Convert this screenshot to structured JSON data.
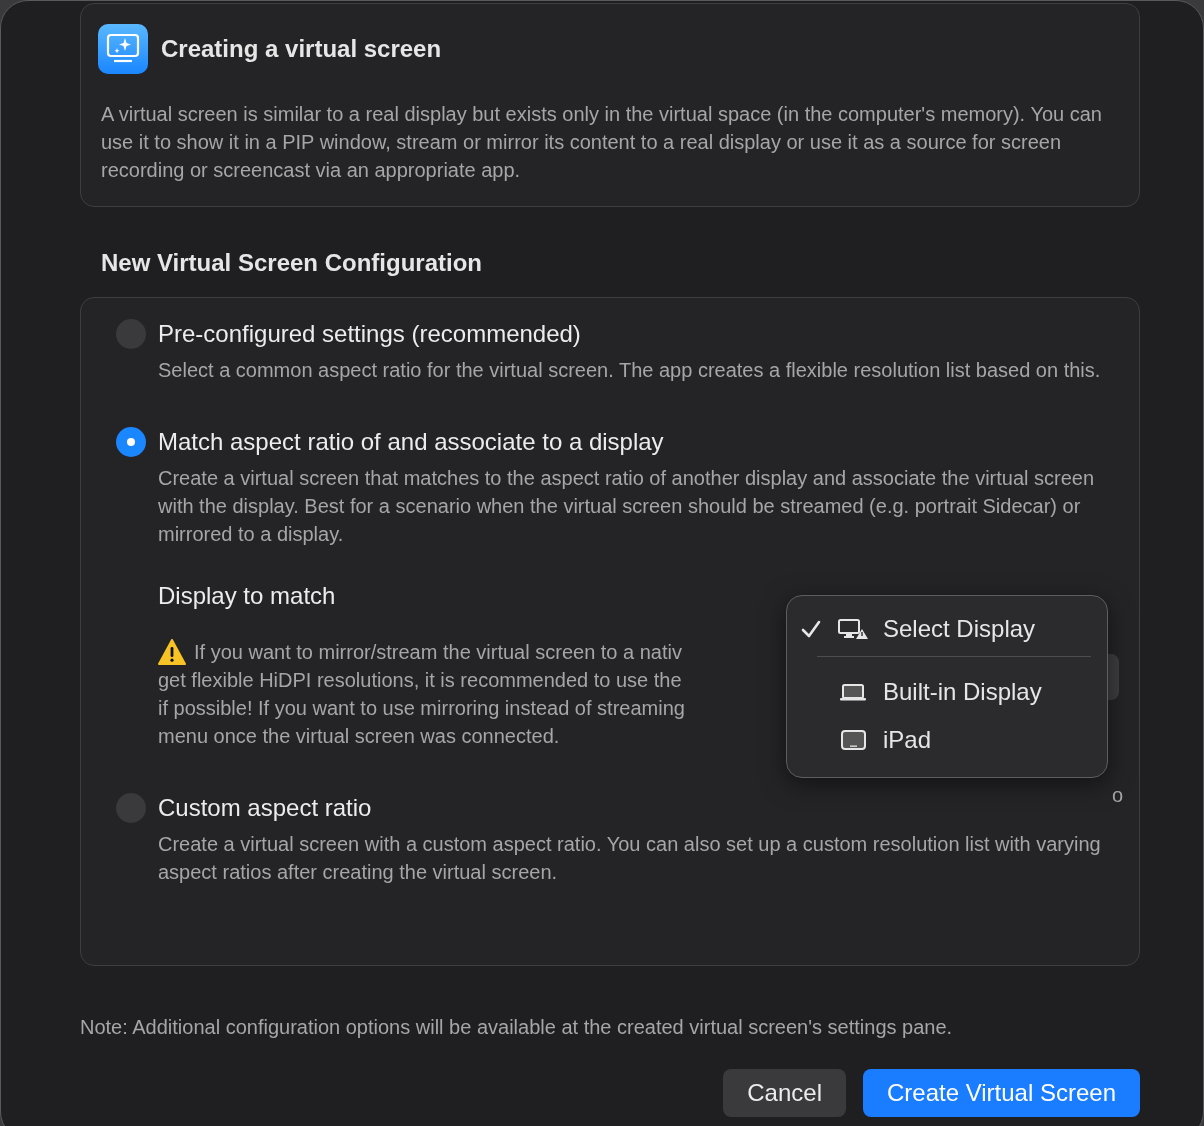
{
  "intro": {
    "title": "Creating a virtual screen",
    "text": "A virtual screen is similar to a real display but exists only in the virtual space (in the computer's memory). You can use it to show it in a PIP window, stream or mirror its content to a real display or use it as a source for screen recording or screencast via an appropriate app."
  },
  "section_title": "New Virtual Screen Configuration",
  "options": [
    {
      "title": "Pre-configured settings (recommended)",
      "selected": false,
      "text": "Select a common aspect ratio for the virtual screen. The app creates a flexible resolution list based on this."
    },
    {
      "title": "Match aspect ratio of and associate to a display",
      "selected": true,
      "text": "Create a virtual screen that matches to the aspect ratio of another display and associate the virtual screen with the display. Best for a scenario when the virtual screen should be streamed (e.g. portrait Sidecar) or mirrored to a display.",
      "display_label": "Display to match",
      "warning_lines": [
        "If you want to mirror/stream the virtual screen to a nativ",
        "get flexible HiDPI resolutions, it is recommended to use the",
        "if possible! If you want to use mirroring instead of streaming",
        "menu once the virtual screen was connected."
      ],
      "warning_tail": "o"
    },
    {
      "title": "Custom aspect ratio",
      "selected": false,
      "text": "Create a virtual screen with a custom aspect ratio. You can also set up a custom resolution list with varying aspect ratios after creating the virtual screen."
    }
  ],
  "menu": {
    "items": [
      {
        "label": "Select Display",
        "kind": "warning-display",
        "checked": true
      },
      {
        "label": "Built-in Display",
        "kind": "laptop",
        "checked": false
      },
      {
        "label": "iPad",
        "kind": "tablet",
        "checked": false
      }
    ]
  },
  "note": "Note: Additional configuration options will be available at the created virtual screen's settings pane.",
  "buttons": [
    {
      "label": "Cancel",
      "kind": "secondary"
    },
    {
      "label": "Create Virtual Screen",
      "kind": "primary"
    }
  ]
}
